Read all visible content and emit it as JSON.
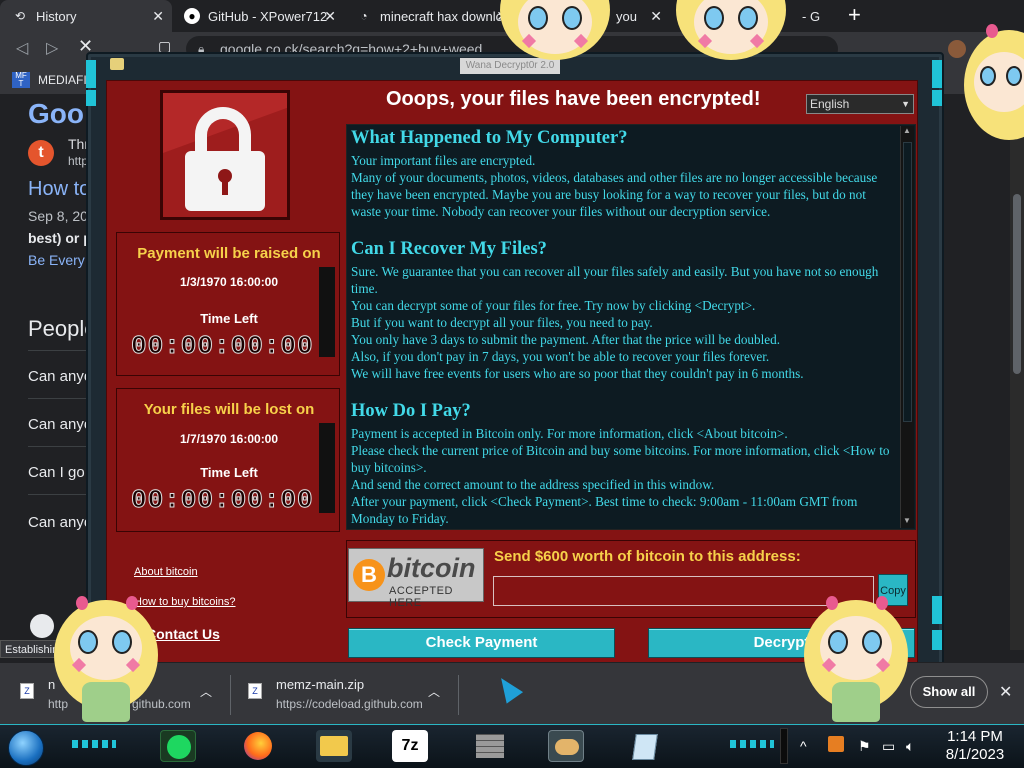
{
  "browser": {
    "tabs": [
      {
        "label": "History",
        "icon": "history-icon"
      },
      {
        "label": "GitHub - XPower712",
        "icon": "github-icon"
      },
      {
        "label": "minecraft hax downlo",
        "icon": "page-icon"
      },
      {
        "label": "you",
        "icon": "page-icon"
      },
      {
        "label": "- G",
        "icon": "page-icon"
      }
    ],
    "new_tab": "+",
    "omnibox_url": "google.co.ck/search?q=how+2+buy+weed",
    "bookmark": "MEDIAFI"
  },
  "results": {
    "logo": "Goo",
    "site_name": "Thri",
    "site_url": "http",
    "result_title": "How to",
    "result_date": "Sep 8, 202",
    "result_snippet": "best) or pa",
    "result_link": "Be Every B",
    "people_heading": "People",
    "questions": [
      "Can anyo",
      "Can anyo",
      "Can I go",
      "Can anyo"
    ]
  },
  "ransom": {
    "window_title": "Wana Decrypt0r 2.0",
    "header": "Ooops, your files have been encrypted!",
    "language": "English",
    "panel_raise": {
      "title": "Payment will be raised on",
      "date": "1/3/1970 16:00:00",
      "time_left_label": "Time Left",
      "timer": "00:00:00:00"
    },
    "panel_lost": {
      "title": "Your files will be lost on",
      "date": "1/7/1970 16:00:00",
      "time_left_label": "Time Left",
      "timer": "00:00:00:00"
    },
    "links": {
      "about_bitcoin": "About bitcoin",
      "how_to_buy": "How to buy bitcoins?",
      "contact_us": "Contact Us"
    },
    "sections": [
      {
        "heading": "What Happened to My Computer?",
        "paragraphs": [
          "Your important files are encrypted.",
          "Many of your documents, photos, videos, databases and other files are no longer accessible because they have been encrypted. Maybe you are busy looking for a way to recover your files, but do not waste your time. Nobody can recover your files without our decryption service."
        ]
      },
      {
        "heading": "Can I Recover My Files?",
        "paragraphs": [
          "Sure. We guarantee that you can recover all your files safely and easily. But you have not so enough time.",
          "You can decrypt some of your files for free. Try now by clicking <Decrypt>.",
          "But if you want to decrypt all your files, you need to pay.",
          "You only have 3 days to submit the payment. After that the price will be doubled.",
          "Also, if you don't pay in 7 days, you won't be able to recover your files forever.",
          "We will have free events for users who are so poor that they couldn't pay in 6 months."
        ]
      },
      {
        "heading": "How Do I Pay?",
        "paragraphs": [
          "Payment is accepted in Bitcoin only. For more information, click <About bitcoin>.",
          "Please check the current price of Bitcoin and buy some bitcoins. For more information, click <How to buy bitcoins>.",
          "And send the correct amount to the address specified in this window.",
          "After your payment, click <Check Payment>. Best time to check: 9:00am - 11:00am GMT from Monday to Friday."
        ]
      }
    ],
    "bitcoin_logo_word": "bitcoin",
    "bitcoin_logo_symbol": "B",
    "bitcoin_accepted": "ACCEPTED HERE",
    "send_label": "Send $600 worth of bitcoin to this address:",
    "address": "",
    "copy_label": "Copy",
    "check_payment_label": "Check Payment",
    "decrypt_label": "Decrypt"
  },
  "downloads": {
    "status_popup": "Establishin",
    "items": [
      {
        "name": "n",
        "url": "http",
        "url_tail": "github.com"
      },
      {
        "name": "memz-main.zip",
        "url": "https://codeload.github.com"
      }
    ],
    "show_all": "Show all"
  },
  "taskbar": {
    "time": "1:14 PM",
    "date": "8/1/2023",
    "pinned_icons": [
      "spotify-icon",
      "firefox-icon",
      "file-explorer-icon",
      "7zip-icon",
      "wall-icon",
      "handshake-icon",
      "notepad-icon"
    ],
    "sevenzip_label": "7z"
  },
  "colors": {
    "ransom_red": "#841313",
    "teal": "#2ab7c4",
    "text_cyan": "#42d9e8",
    "warning_yellow": "#f7d14a",
    "bitcoin_orange": "#f7931a"
  }
}
